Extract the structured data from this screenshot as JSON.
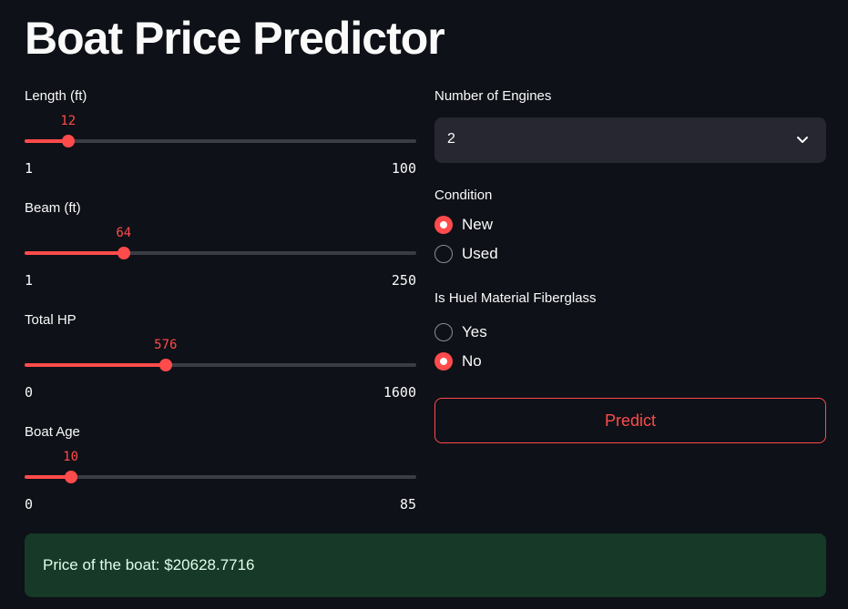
{
  "page": {
    "title": "Boat Price Predictor"
  },
  "sliders": [
    {
      "label": "Length (ft)",
      "value": 12,
      "min": 1,
      "max": 100,
      "value_text": "12",
      "min_text": "1",
      "max_text": "100"
    },
    {
      "label": "Beam (ft)",
      "value": 64,
      "min": 1,
      "max": 250,
      "value_text": "64",
      "min_text": "1",
      "max_text": "250"
    },
    {
      "label": "Total HP",
      "value": 576,
      "min": 0,
      "max": 1600,
      "value_text": "576",
      "min_text": "0",
      "max_text": "1600"
    },
    {
      "label": "Boat Age",
      "value": 10,
      "min": 0,
      "max": 85,
      "value_text": "10",
      "min_text": "0",
      "max_text": "85"
    }
  ],
  "engines": {
    "label": "Number of Engines",
    "selected": "2",
    "icon": "chevron-down-icon"
  },
  "condition": {
    "label": "Condition",
    "options": [
      {
        "label": "New",
        "checked": true
      },
      {
        "label": "Used",
        "checked": false
      }
    ]
  },
  "fiberglass": {
    "label": "Is Huel Material Fiberglass",
    "options": [
      {
        "label": "Yes",
        "checked": false
      },
      {
        "label": "No",
        "checked": true
      }
    ]
  },
  "predict": {
    "label": "Predict"
  },
  "result": {
    "text": "Price of the boat: $20628.7716"
  },
  "colors": {
    "background": "#0e1117",
    "accent": "#ff4b4b",
    "track": "#3b3d45",
    "select_bg": "#262730",
    "success_bg": "#173928",
    "success_text": "#dffde9"
  }
}
